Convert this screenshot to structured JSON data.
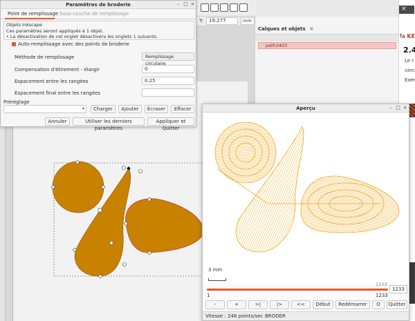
{
  "colors": {
    "accent": "#e9562a",
    "fill_shape": "#c88200",
    "stitch": "#f2a81d",
    "selected_row": "#f5c6c4"
  },
  "inkscape": {
    "coord_y_label": "Y:",
    "coord_y_value": "19.277",
    "unit": "mm",
    "layers_tab": "Calques et objets",
    "layers_close": "×",
    "path_item": "path3403",
    "toolbar_icons": [
      "text-tool-icon",
      "pen-tool-icon",
      "node-tool-icon",
      "spiral-tool-icon",
      "image-icon",
      "align-icon",
      "star-icon",
      "paint-icon"
    ]
  },
  "browser_doc": {
    "fragment1_prefix": "fa",
    "fragment1_accent": "KE",
    "fragment2": "2.4",
    "fragment3": "Le r",
    "fragment4": "cerc",
    "fragment5": "Exer"
  },
  "params_dialog": {
    "title": "Paramètres de broderie",
    "tabs": [
      "Point de remplissage",
      "Sous-couche de remplissage"
    ],
    "group_title": "Objets Inkscape",
    "group_line1": "Ces paramètres seront appliqués à 1 objet.",
    "group_line2": "• La désactivation de cet onglet désactivera les onglets 1 suivants.",
    "auto_fill_label": "Auto-remplissage avec des points de broderie",
    "fields": [
      {
        "label": "Méthode de remplissage",
        "value": "Remplissage circulaire"
      },
      {
        "label": "Compensation d'étirement - élargir",
        "value": "0"
      },
      {
        "label": "Espacement entre les rangées",
        "value": "0.25"
      },
      {
        "label": "Espacement final entre les rangées",
        "value": ""
      }
    ],
    "preset_label": "Préréglage",
    "buttons": {
      "load": "Charger",
      "add": "Ajouter",
      "overwrite": "Écraser",
      "delete": "Effacer",
      "cancel": "Annuler",
      "use_last": "Utiliser les derniers paramètres",
      "apply_quit": "Appliquer et Quitter"
    }
  },
  "preview": {
    "title": "Aperçu",
    "scale_label": "3 mm",
    "slider": {
      "min": "1",
      "max": "1233",
      "top_value": "1233",
      "current": "1233",
      "fraction": 1.0
    },
    "buttons": [
      "-",
      "+",
      ">|",
      "|>",
      "<<",
      "Début",
      "Redémarrer",
      "O",
      "Quitter"
    ],
    "status_speed": "Vitesse : 246 points/sec",
    "status_mode": "BRODER"
  }
}
